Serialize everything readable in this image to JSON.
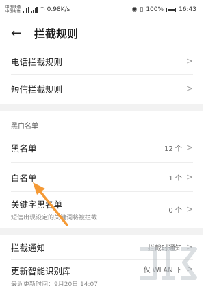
{
  "status_bar": {
    "carrier_1": "中国联通",
    "carrier_2": "中国电信",
    "network_speed": "0.98K/s",
    "battery": "100%",
    "time": "16:43"
  },
  "header": {
    "title": "拦截规则",
    "back_icon": "back-arrow-icon"
  },
  "rules": {
    "call_rules": "电话拦截规则",
    "sms_rules": "短信拦截规则"
  },
  "lists": {
    "section_title": "黑白名单",
    "blacklist_label": "黑名单",
    "blacklist_count": "12 个",
    "whitelist_label": "白名单",
    "whitelist_count": "1 个",
    "keyword_label": "关键字黑名单",
    "keyword_desc": "短信出现设定的关键词将被拦截",
    "keyword_count": "0 个"
  },
  "notify": {
    "label": "拦截通知",
    "value": "拦截时通知"
  },
  "update": {
    "label": "更新智能识别库",
    "value": "仅 WLAN 下",
    "last_update": "最近更新时间：9月20日 14:07"
  },
  "colors": {
    "arrow": "#f59a36",
    "chevron": "#999999"
  }
}
